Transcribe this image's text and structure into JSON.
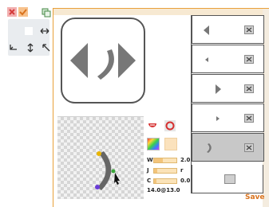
{
  "toolbar": {
    "icons": [
      "cancel-icon",
      "check-icon",
      "copy-icon",
      "flip-horizontal-icon",
      "rotate-left-icon",
      "flip-vertical-icon",
      "rotate-right-icon"
    ]
  },
  "properties": {
    "width_label": "W",
    "width_value": "2.0",
    "join_label": "J",
    "join_value": "r",
    "cap_label": "C",
    "cap_value": "0.0",
    "coordinates": "14.0@13.0"
  },
  "states": [
    {
      "name": "state-1",
      "glyph": "left-arrow-large"
    },
    {
      "name": "state-2",
      "glyph": "left-arrow-small"
    },
    {
      "name": "state-3",
      "glyph": "right-arrow-large"
    },
    {
      "name": "state-4",
      "glyph": "right-arrow-small"
    },
    {
      "name": "state-5",
      "glyph": "curve",
      "selected": true
    }
  ],
  "actions": {
    "save_label": "Save"
  },
  "colors": {
    "accent": "#e9a03a",
    "save_text": "#d9731e",
    "icon_gray": "#777777"
  }
}
